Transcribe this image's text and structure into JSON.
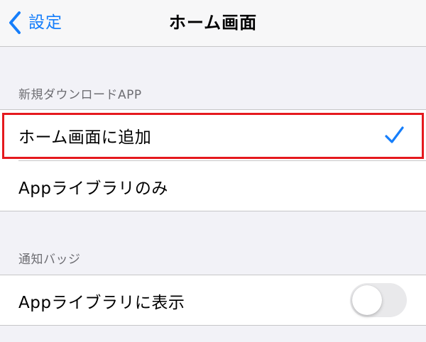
{
  "nav": {
    "back_label": "設定",
    "title": "ホーム画面"
  },
  "sections": [
    {
      "header": "新規ダウンロードAPP",
      "rows": [
        {
          "label": "ホーム画面に追加",
          "selected": true,
          "accessory": "checkmark-icon"
        },
        {
          "label": "Appライブラリのみ",
          "selected": false
        }
      ]
    },
    {
      "header": "通知バッジ",
      "rows": [
        {
          "label": "Appライブラリに表示",
          "toggle_on": false
        }
      ]
    }
  ],
  "colors": {
    "accent": "#157efb",
    "highlight": "#e5191e",
    "background": "#f2f2f7",
    "toggle_off": "#e9e9eb"
  }
}
